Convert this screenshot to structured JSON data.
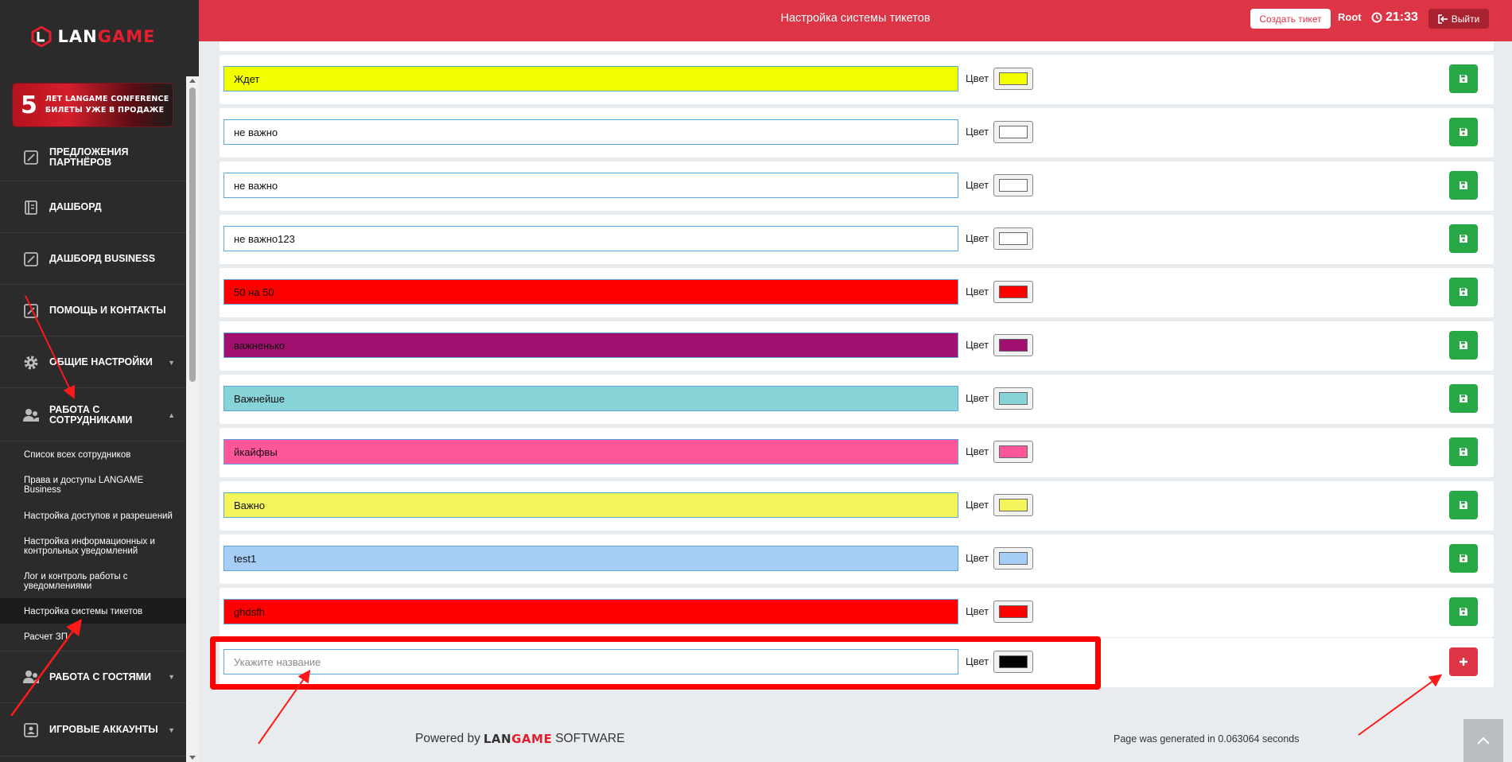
{
  "sidebar": {
    "logo": {
      "prefix": "LAN",
      "suffix": "GAME"
    },
    "promo": {
      "number": "5",
      "line1": "ЛЕТ LANGAME CONFERENCE",
      "line2": "БИЛЕТЫ УЖЕ В ПРОДАЖЕ"
    },
    "items": [
      {
        "label": "Предложения партнёров",
        "icon": "edit-square-icon"
      },
      {
        "label": "Дашборд",
        "icon": "notebook-icon"
      },
      {
        "label": "Дашборд Business",
        "icon": "edit-square-icon"
      },
      {
        "label": "Помощь и контакты",
        "icon": "edit-square-icon"
      },
      {
        "label": "Общие настройки",
        "icon": "gear-icon"
      },
      {
        "label": "Работа с сотрудниками",
        "icon": "users-icon"
      },
      {
        "label": "Работа с гостями",
        "icon": "users-icon"
      },
      {
        "label": "Игровые аккаунты",
        "icon": "id-card-icon"
      }
    ],
    "subitems": [
      "Список всех сотрудников",
      "Права и доступы LANGAME Business",
      "Настройка доступов и разрешений",
      "Настройка информационных и контрольных уведомлений",
      "Лог и контроль работы с уведомлениями",
      "Настройка системы тикетов",
      "Расчет ЗП"
    ]
  },
  "header": {
    "title": "Настройка системы тикетов",
    "create_ticket": "Создать тикет",
    "user": "Root",
    "time": "21:33",
    "logout": "Выйти"
  },
  "tickets": {
    "color_label": "Цвет",
    "rows": [
      {
        "name": "Ждет",
        "color": "#f2ff00"
      },
      {
        "name": "не важно",
        "color": "#ffffff"
      },
      {
        "name": "не важно",
        "color": "#ffffff"
      },
      {
        "name": "не важно123",
        "color": "#ffffff"
      },
      {
        "name": "50 на 50",
        "color": "#ff0000"
      },
      {
        "name": "важненько",
        "color": "#a1106e"
      },
      {
        "name": "Важнейше",
        "color": "#86d4d8"
      },
      {
        "name": "йкайфвы",
        "color": "#ff5599"
      },
      {
        "name": "Важно",
        "color": "#f4f55a"
      },
      {
        "name": "test1",
        "color": "#a5cdf5"
      },
      {
        "name": "ghdsfh",
        "color": "#ff0000"
      }
    ],
    "new_row": {
      "placeholder": "Укажите название",
      "color": "#000000"
    }
  },
  "footer": {
    "powered_by": "Powered by",
    "brand_prefix": "LAN",
    "brand_suffix": "GAME",
    "software": "SOFTWARE",
    "generated": "Page was generated in 0.063064 seconds"
  },
  "colors": {
    "header": "#dd3545",
    "sidebar": "#2b2b2b",
    "save": "#28a745",
    "add": "#dc3545"
  }
}
